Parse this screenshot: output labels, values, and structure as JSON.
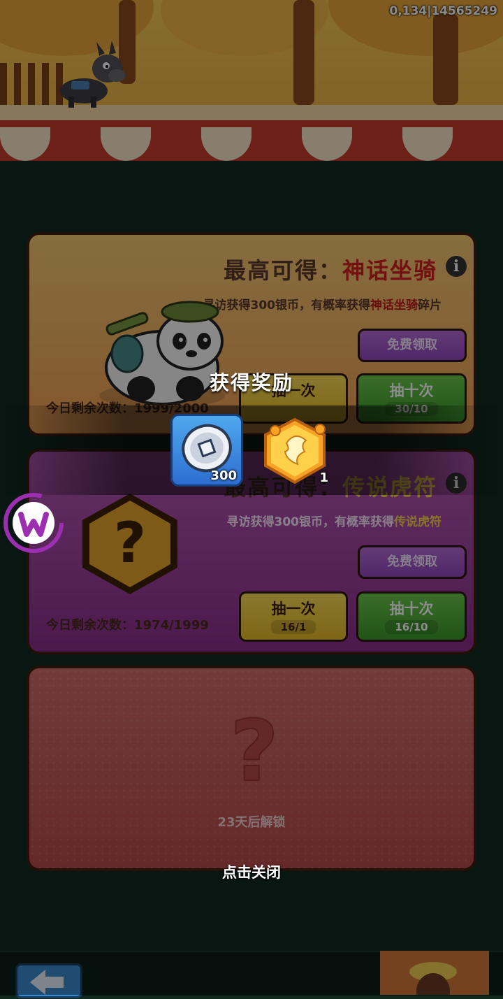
{
  "hud": {
    "coords_text": "0,134|14565249"
  },
  "cards": [
    {
      "title_prefix": "最高可得：",
      "title_highlight": "神话坐骑",
      "desc_prefix": "寻访获得300银币，有概率获得",
      "desc_highlight": "神话坐骑",
      "desc_suffix": "碎片",
      "free_label": "免费领取",
      "draw_one_label": "抽一次",
      "draw_one_cost": "",
      "draw_ten_label": "抽十次",
      "draw_ten_cost": "30/10",
      "remaining_text": "今日剩余次数：1999/2000"
    },
    {
      "title_prefix": "最高可得：",
      "title_highlight": "传说虎符",
      "desc_prefix": "寻访获得300银币，有概率获得",
      "desc_highlight": "传说虎符",
      "desc_suffix": "",
      "free_label": "免费领取",
      "draw_one_label": "抽一次",
      "draw_one_cost": "16/1",
      "draw_ten_label": "抽十次",
      "draw_ten_cost": "16/10",
      "remaining_text": "今日剩余次数：1974/1999"
    },
    {
      "unlock_text": "23天后解锁"
    }
  ],
  "reward_popup": {
    "title": "获得奖励",
    "items": [
      {
        "icon": "silver-coin-icon",
        "count": "300"
      },
      {
        "icon": "mythic-mount-fragment-icon",
        "count": "1"
      }
    ],
    "close_hint": "点击关闭"
  },
  "colors": {
    "highlight_red": "#d21f1f",
    "card1_bg": "#f3c773",
    "card2_bg": "#b558b4",
    "card3_bg": "#cf6d6d",
    "free_button": "#a65ccc",
    "draw_one_button": "#f1cd42",
    "draw_ten_button": "#52b33a"
  }
}
